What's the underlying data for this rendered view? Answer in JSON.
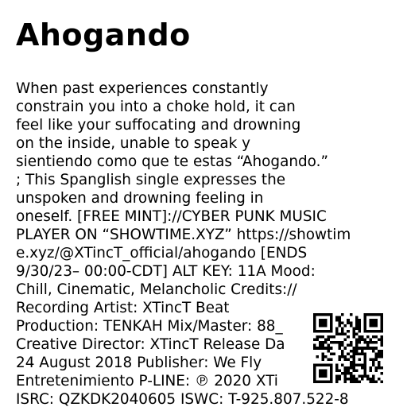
{
  "page": {
    "title": "Ahogando",
    "description_lines": [
      "When past experiences constantly",
      "constrain you into a choke hold, it can",
      "feel like your suffocating and drowning",
      "on the inside, unable to speak y",
      "sientiendo como que te estas “Ahogando.”",
      "; This Spanglish single expresses the",
      "unspoken and drowning feeling in",
      "oneself. [FREE MINT]://CYBER PUNK MUSIC",
      "PLAYER ON “SHOWTIME.XYZ” https://showtim",
      "e.xyz/@XTincT_official/ahogando [ENDS",
      "9/30/23– 00:00-CDT] ALT KEY: 11A Mood:",
      "Chill, Cinematic, Melancholic Credits://",
      "Recording Artist: XTincT Beat",
      "Production: TENKAH Mix/Master: 88_",
      "Creative Director: XTincT Release Da",
      "24 August 2018 Publisher: We Fly",
      "Entretenimiento P-LINE: ℗ 2020 XTi",
      "ISRC: QZKDK2040605 ISWC: T-925.807.522-8"
    ]
  },
  "qr_code": {
    "icon": "qr-code-icon",
    "color": "#000000",
    "background": "#ffffff"
  }
}
